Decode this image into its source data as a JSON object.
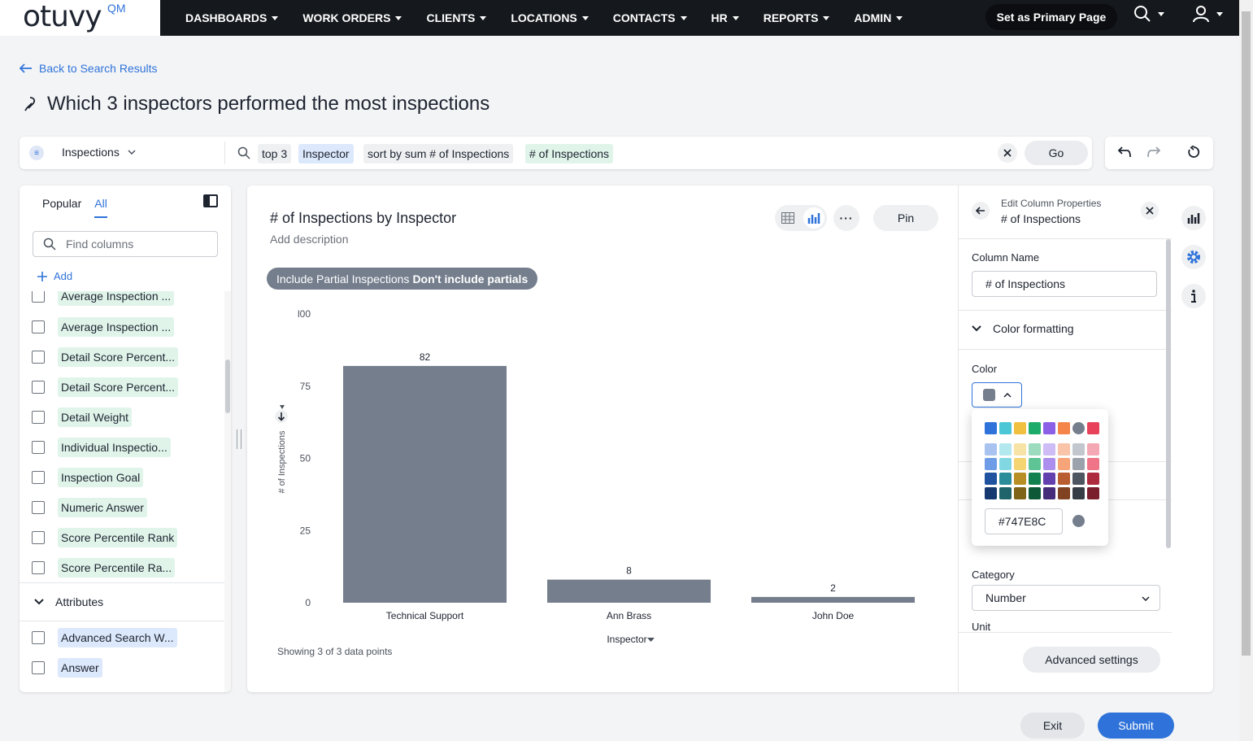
{
  "brand": {
    "logo_text": "otuvy",
    "logo_sup": "QM"
  },
  "nav": {
    "items": [
      {
        "label": "DASHBOARDS"
      },
      {
        "label": "WORK ORDERS"
      },
      {
        "label": "CLIENTS"
      },
      {
        "label": "LOCATIONS"
      },
      {
        "label": "CONTACTS"
      },
      {
        "label": "HR"
      },
      {
        "label": "REPORTS"
      },
      {
        "label": "ADMIN"
      }
    ],
    "primary_button": "Set as Primary Page"
  },
  "page": {
    "back_link": "Back to Search Results",
    "title": "Which 3 inspectors performed the most inspections"
  },
  "search": {
    "source": "Inspections",
    "tokens": [
      "top 3",
      "Inspector",
      "sort by sum # of Inspections",
      "# of Inspections"
    ],
    "go_label": "Go"
  },
  "left_panel": {
    "tabs": [
      "Popular",
      "All"
    ],
    "active_tab": "All",
    "find_placeholder": "Find columns",
    "add_label": "Add",
    "measures": [
      "Average Inspection ...",
      "Average Inspection ...",
      "Detail Score Percent...",
      "Detail Score Percent...",
      "Detail Weight",
      "Individual Inspectio...",
      "Inspection Goal",
      "Numeric Answer",
      "Score Percentile Rank",
      "Score Percentile Ra..."
    ],
    "attributes_header": "Attributes",
    "attributes": [
      "Advanced Search W...",
      "Answer"
    ]
  },
  "chart": {
    "title": "# of Inspections by Inspector",
    "description": "Add description",
    "pin_label": "Pin",
    "filter_label": "Include Partial Inspections",
    "filter_value": "Don't include partials",
    "showing_text": "Showing 3 of 3 data points",
    "bar_color": "#747E8C"
  },
  "chart_data": {
    "type": "bar",
    "categories": [
      "Technical Support",
      "Ann Brass",
      "John Doe"
    ],
    "values": [
      82,
      8,
      2
    ],
    "xlabel": "Inspector",
    "ylabel": "# of Inspections",
    "ylim": [
      0,
      100
    ],
    "yticks": [
      "0",
      "25",
      "50",
      "75",
      "l00"
    ],
    "data_labels": true
  },
  "edit_props": {
    "subtitle": "Edit Column Properties",
    "title": "# of Inspections",
    "column_name_label": "Column Name",
    "column_name_value": "# of Inspections",
    "color_formatting_label": "Color formatting",
    "color_label": "Color",
    "category_label": "Category",
    "category_value": "Number",
    "unit_label": "Unit",
    "advanced_label": "Advanced settings"
  },
  "color_picker": {
    "hex_value": "#747E8C",
    "base_row": [
      "#2f73da",
      "#4cc7d6",
      "#f1c040",
      "#1cab6b",
      "#8b5fe6",
      "#f5844a",
      "#747e8c",
      "#e8425a"
    ],
    "tint_rows": [
      [
        "#a9c3f0",
        "#b3e8ee",
        "#f8e3a6",
        "#9cdbbd",
        "#cdbcf6",
        "#f9c4a7",
        "#c2c7cd",
        "#f4a8b4"
      ],
      [
        "#6e9ce6",
        "#82d8e2",
        "#f5d472",
        "#5fc495",
        "#ac8eee",
        "#f7a479",
        "#9ba2ac",
        "#ef7487"
      ],
      [
        "#20539f",
        "#2b8d99",
        "#b88f25",
        "#13804f",
        "#6240ad",
        "#b95e31",
        "#4e5661",
        "#ae2a3f"
      ],
      [
        "#163a70",
        "#1f636b",
        "#7f6319",
        "#0d5937",
        "#452d79",
        "#814222",
        "#373d45",
        "#7a1d2c"
      ]
    ]
  },
  "footer": {
    "exit_label": "Exit",
    "submit_label": "Submit"
  }
}
